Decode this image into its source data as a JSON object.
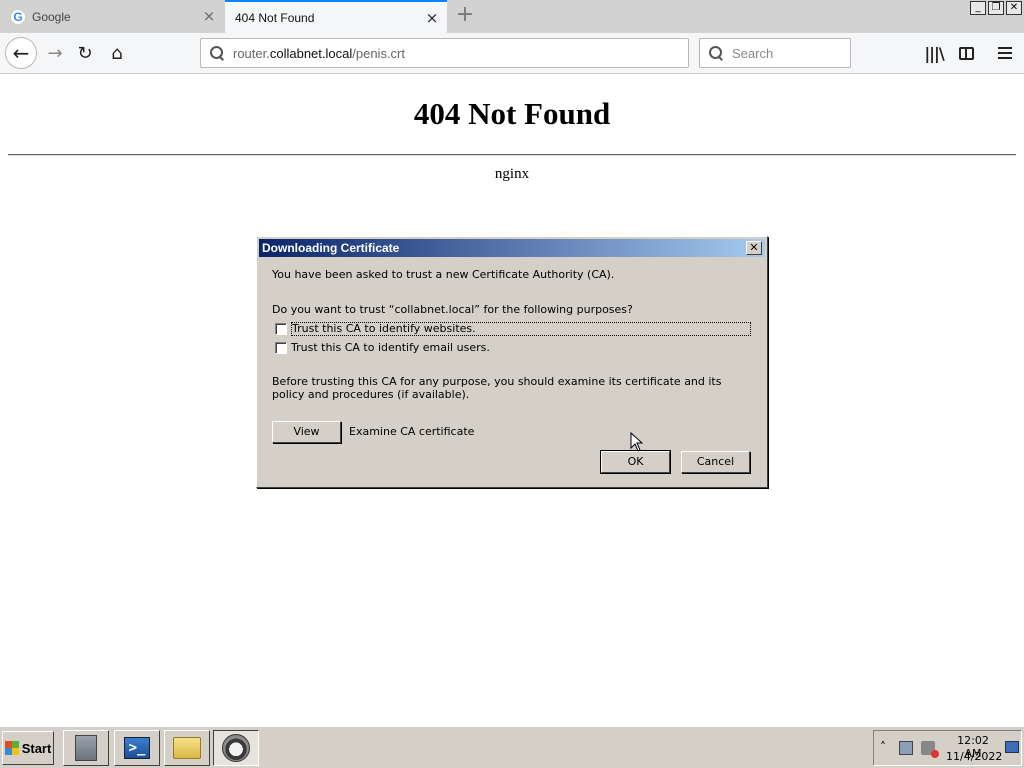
{
  "browser": {
    "tabs": [
      {
        "label": "Google",
        "active": false
      },
      {
        "label": "404 Not Found",
        "active": true
      }
    ],
    "new_tab_symbol": "+",
    "url": {
      "prefix": "router.",
      "host": "collabnet.local",
      "path": "/penis.crt"
    },
    "search_placeholder": "Search",
    "window_controls": {
      "minimize": "_",
      "restore": "❐",
      "close": "✕"
    }
  },
  "page": {
    "heading": "404 Not Found",
    "server": "nginx"
  },
  "dialog": {
    "title": "Downloading Certificate",
    "close_symbol": "✕",
    "intro": "You have been asked to trust a new Certificate Authority (CA).",
    "question": "Do you want to trust “collabnet.local” for the following purposes?",
    "options": [
      {
        "label": "Trust this CA to identify websites.",
        "checked": false
      },
      {
        "label": "Trust this CA to identify email users.",
        "checked": false
      }
    ],
    "warning": "Before trusting this CA for any purpose, you should examine its certificate and its policy and procedures (if available).",
    "view_button": "View",
    "examine_label": "Examine CA certificate",
    "ok_button": "OK",
    "cancel_button": "Cancel"
  },
  "taskbar": {
    "start_label": "Start",
    "apps": [
      "server-manager-icon",
      "powershell-icon",
      "file-explorer-icon",
      "firefox-raccoon-icon"
    ],
    "shell_glyph": ">_",
    "tray_chevron": "˄",
    "time": "12:02 AM",
    "date": "11/4/2022"
  },
  "colors": {
    "accent": "#0a84ff",
    "dialog_title_start": "#0a246a",
    "dialog_title_end": "#a6caf0",
    "dialog_face": "#d4d0c8"
  }
}
